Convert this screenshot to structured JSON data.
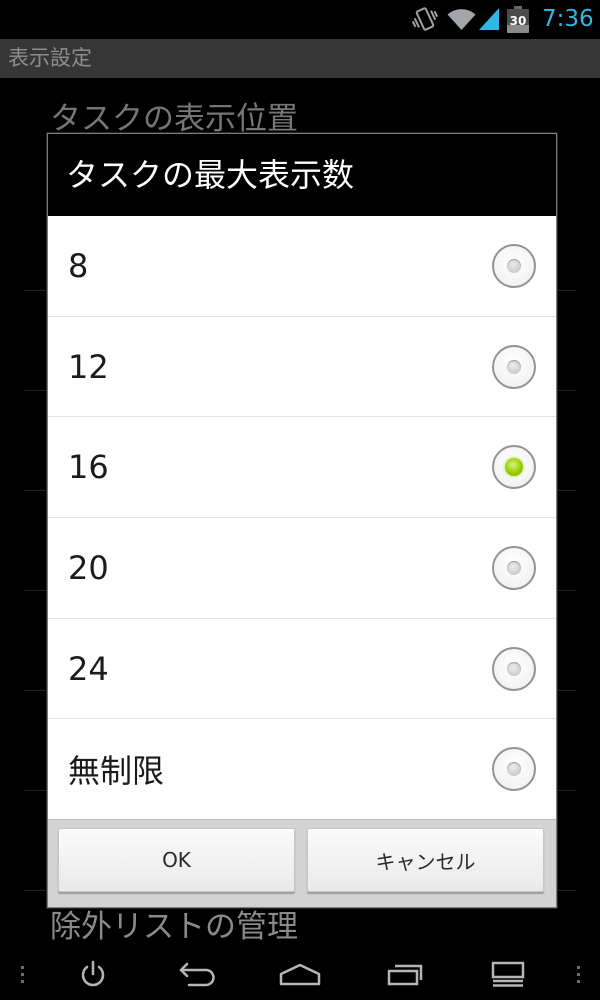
{
  "status_bar": {
    "time": "7:36",
    "battery_level": "30",
    "time_color": "#33b5e5",
    "icons": [
      "vibrate-icon",
      "wifi-icon",
      "signal-icon",
      "battery-icon"
    ]
  },
  "action_bar": {
    "title": "表示設定"
  },
  "background_preferences": {
    "items": [
      {
        "title": "タスクの表示位置"
      },
      {
        "title": "除外リストの管理"
      }
    ]
  },
  "dialog": {
    "title": "タスクの最大表示数",
    "options": [
      {
        "label": "8",
        "selected": false
      },
      {
        "label": "12",
        "selected": false
      },
      {
        "label": "16",
        "selected": true
      },
      {
        "label": "20",
        "selected": false
      },
      {
        "label": "24",
        "selected": false
      },
      {
        "label": "無制限",
        "selected": false
      }
    ],
    "buttons": {
      "ok": "OK",
      "cancel": "キャンセル"
    },
    "accent_color": "#99cc00"
  },
  "nav_bar": {
    "icons": [
      "menu-dots-icon",
      "power-icon",
      "back-icon",
      "home-icon",
      "recents-icon",
      "screen-icon",
      "menu-dots-icon"
    ]
  }
}
